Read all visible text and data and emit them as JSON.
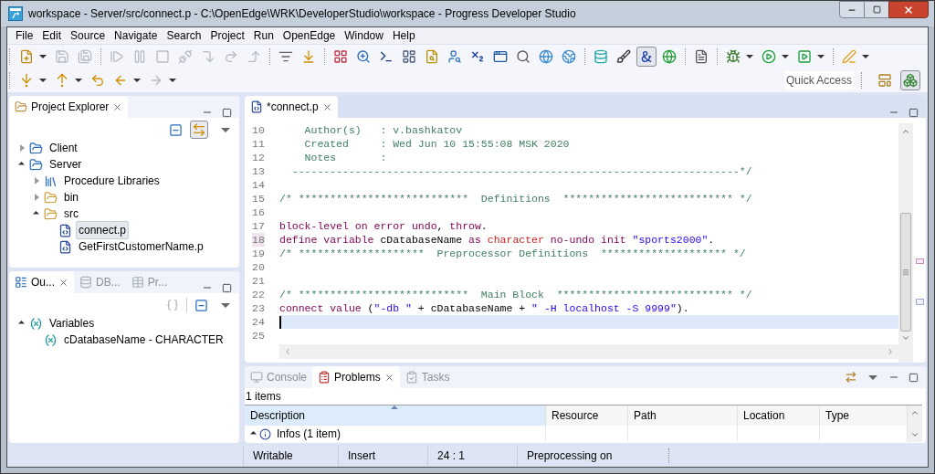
{
  "window": {
    "title": "workspace - Server/src/connect.p - C:\\OpenEdge\\WRK\\DeveloperStudio\\workspace - Progress Developer Studio"
  },
  "menu": [
    "File",
    "Edit",
    "Source",
    "Navigate",
    "Search",
    "Project",
    "Run",
    "OpenEdge",
    "Window",
    "Help"
  ],
  "toolbar_1": [
    {
      "kind": "new",
      "disabled": false,
      "pressed": false,
      "menu": true
    },
    {
      "kind": "save",
      "disabled": true,
      "pressed": false,
      "menu": false
    },
    {
      "kind": "save_all",
      "disabled": true,
      "pressed": false,
      "menu": false
    },
    {
      "kind": "separator"
    },
    {
      "kind": "resume",
      "disabled": true,
      "pressed": false,
      "menu": false
    },
    {
      "kind": "suspend",
      "disabled": true,
      "pressed": false,
      "menu": false
    },
    {
      "kind": "terminate",
      "disabled": true,
      "pressed": false,
      "menu": false
    },
    {
      "kind": "disconnect",
      "disabled": true,
      "pressed": false,
      "menu": false
    },
    {
      "kind": "step_into",
      "disabled": true,
      "pressed": false,
      "menu": false
    },
    {
      "kind": "step_over",
      "disabled": true,
      "pressed": false,
      "menu": false
    },
    {
      "kind": "step_return",
      "disabled": true,
      "pressed": false,
      "menu": false
    },
    {
      "kind": "separator"
    },
    {
      "kind": "step_filters",
      "disabled": false,
      "pressed": false,
      "menu": false
    },
    {
      "kind": "drop_frame",
      "disabled": false,
      "pressed": false,
      "menu": false
    },
    {
      "kind": "separator"
    },
    {
      "kind": "grid",
      "disabled": false,
      "pressed": false,
      "menu": false
    },
    {
      "kind": "zoom",
      "disabled": false,
      "pressed": false,
      "menu": false
    },
    {
      "kind": "terminal",
      "disabled": false,
      "pressed": false,
      "menu": false
    },
    {
      "kind": "layout",
      "disabled": false,
      "pressed": false,
      "menu": false
    },
    {
      "kind": "file_search",
      "disabled": false,
      "pressed": false,
      "menu": false
    },
    {
      "kind": "user_search",
      "disabled": false,
      "pressed": false,
      "menu": false
    },
    {
      "kind": "subscript",
      "disabled": false,
      "pressed": false,
      "menu": false
    },
    {
      "kind": "app_window",
      "disabled": false,
      "pressed": false,
      "menu": false
    },
    {
      "kind": "search",
      "disabled": false,
      "pressed": false,
      "menu": false
    },
    {
      "kind": "globe",
      "disabled": false,
      "pressed": false,
      "menu": false
    },
    {
      "kind": "earth",
      "disabled": false,
      "pressed": false,
      "menu": false
    },
    {
      "kind": "separator"
    },
    {
      "kind": "database",
      "disabled": false,
      "pressed": false,
      "menu": false
    },
    {
      "kind": "brush",
      "disabled": false,
      "pressed": false,
      "menu": false
    },
    {
      "kind": "ampersand",
      "disabled": false,
      "pressed": true,
      "menu": false
    },
    {
      "kind": "globe_run",
      "disabled": false,
      "pressed": false,
      "menu": false
    },
    {
      "kind": "separator"
    },
    {
      "kind": "document",
      "disabled": false,
      "pressed": false,
      "menu": false
    },
    {
      "kind": "separator"
    },
    {
      "kind": "debug",
      "disabled": false,
      "pressed": false,
      "menu": true
    },
    {
      "kind": "run",
      "disabled": false,
      "pressed": false,
      "menu": true
    },
    {
      "kind": "run_config",
      "disabled": false,
      "pressed": false,
      "menu": true
    },
    {
      "kind": "separator"
    },
    {
      "kind": "pen",
      "disabled": false,
      "pressed": false,
      "menu": true
    }
  ],
  "toolbar_2": [
    {
      "kind": "next_annotation",
      "disabled": false,
      "pressed": false,
      "menu": true
    },
    {
      "kind": "prev_annotation",
      "disabled": false,
      "pressed": false,
      "menu": true
    },
    {
      "kind": "last_edit",
      "disabled": false,
      "pressed": false,
      "menu": false
    },
    {
      "kind": "back",
      "disabled": false,
      "pressed": false,
      "menu": true
    },
    {
      "kind": "forward",
      "disabled": true,
      "pressed": false,
      "menu": true
    }
  ],
  "quick_access": {
    "placeholder": "Quick Access"
  },
  "perspectives": [
    {
      "kind": "layout_add",
      "selected": false
    },
    {
      "kind": "openedge",
      "selected": true
    }
  ],
  "project_explorer": {
    "tabs": [
      {
        "label": "Project Explorer",
        "selected": true
      }
    ],
    "link_with_editor": true,
    "tree": [
      {
        "label": "Client",
        "kind": "project",
        "expanded": false,
        "selected": false
      },
      {
        "label": "Server",
        "kind": "project",
        "expanded": true,
        "selected": false,
        "children": [
          {
            "label": "Procedure Libraries",
            "kind": "library",
            "expanded": false,
            "selected": false
          },
          {
            "label": "bin",
            "kind": "folder",
            "expanded": false,
            "selected": false
          },
          {
            "label": "src",
            "kind": "folder",
            "expanded": true,
            "selected": false,
            "children": [
              {
                "label": "connect.p",
                "kind": "file",
                "selected": true
              },
              {
                "label": "GetFirstCustomerName.p",
                "kind": "file",
                "selected": false
              }
            ]
          }
        ]
      }
    ]
  },
  "outline": {
    "tabs": [
      {
        "label": "Ou...",
        "kind": "outline",
        "selected": true
      },
      {
        "label": "DB...",
        "kind": "db",
        "selected": false
      },
      {
        "label": "Pr...",
        "kind": "properties",
        "selected": false
      }
    ],
    "tree": [
      {
        "label": "Variables",
        "kind": "group",
        "expanded": true,
        "children": [
          {
            "label": "cDatabaseName - CHARACTER",
            "kind": "variable"
          }
        ]
      }
    ]
  },
  "editor": {
    "tabs": [
      {
        "label": "*connect.p",
        "selected": true
      }
    ],
    "lines": [
      {
        "number": "10",
        "current": false,
        "marked": false,
        "tokens": [
          {
            "kind": "comment",
            "text": "    Author(s)   : v.bashkatov"
          }
        ]
      },
      {
        "number": "11",
        "current": false,
        "marked": false,
        "tokens": [
          {
            "kind": "comment",
            "text": "    Created     : Wed Jun 10 15:55:08 MSK 2020"
          }
        ]
      },
      {
        "number": "12",
        "current": false,
        "marked": false,
        "tokens": [
          {
            "kind": "comment",
            "text": "    Notes       :"
          }
        ]
      },
      {
        "number": "13",
        "current": false,
        "marked": false,
        "tokens": [
          {
            "kind": "comment",
            "text": "  -----------------------------------------------------------------------*/"
          }
        ]
      },
      {
        "number": "14",
        "current": false,
        "marked": false
      },
      {
        "number": "15",
        "current": false,
        "marked": false,
        "tokens": [
          {
            "kind": "comment",
            "text": "/* ***************************  Definitions  *************************** */"
          }
        ]
      },
      {
        "number": "16",
        "current": false,
        "marked": false
      },
      {
        "number": "17",
        "current": false,
        "marked": false,
        "tokens": [
          {
            "kind": "keyword",
            "text": "block-level on error undo"
          },
          {
            "kind": "plain",
            "text": ", "
          },
          {
            "kind": "keyword",
            "text": "throw"
          },
          {
            "kind": "plain",
            "text": "."
          }
        ]
      },
      {
        "number": "18",
        "current": false,
        "marked": true,
        "tokens": [
          {
            "kind": "keyword",
            "text": "define variable"
          },
          {
            "kind": "plain",
            "text": " cDatabaseName "
          },
          {
            "kind": "keyword",
            "text": "as "
          },
          {
            "kind": "type",
            "text": "character "
          },
          {
            "kind": "keyword",
            "text": "no-undo init "
          },
          {
            "kind": "string",
            "text": "\"sports2000\""
          },
          {
            "kind": "plain",
            "text": "."
          }
        ]
      },
      {
        "number": "19",
        "current": false,
        "marked": false,
        "tokens": [
          {
            "kind": "comment",
            "text": "/* ********************  Preprocessor Definitions  ******************** */"
          }
        ]
      },
      {
        "number": "20",
        "current": false,
        "marked": false
      },
      {
        "number": "21",
        "current": false,
        "marked": false
      },
      {
        "number": "22",
        "current": false,
        "marked": false,
        "tokens": [
          {
            "kind": "comment",
            "text": "/* ***************************  Main Block  **************************** */"
          }
        ]
      },
      {
        "number": "23",
        "current": false,
        "marked": false,
        "tokens": [
          {
            "kind": "keyword",
            "text": "connect value"
          },
          {
            "kind": "plain",
            "text": " ("
          },
          {
            "kind": "string",
            "text": "\"-db \""
          },
          {
            "kind": "plain",
            "text": " + cDatabaseName + "
          },
          {
            "kind": "string",
            "text": "\" -H localhost -S 9999\""
          },
          {
            "kind": "plain",
            "text": ")."
          }
        ]
      },
      {
        "number": "24",
        "current": true,
        "marked": false
      },
      {
        "number": "25",
        "current": false,
        "marked": false
      }
    ]
  },
  "problems": {
    "tabs": [
      {
        "label": "Console",
        "kind": "console",
        "selected": false
      },
      {
        "label": "Problems",
        "kind": "problems",
        "selected": true
      },
      {
        "label": "Tasks",
        "kind": "tasks",
        "selected": false
      }
    ],
    "summary": "1 items",
    "columns": [
      {
        "label": "Description",
        "sorted": true
      },
      {
        "label": "Resource",
        "sorted": false
      },
      {
        "label": "Path",
        "sorted": false
      },
      {
        "label": "Location",
        "sorted": false
      },
      {
        "label": "Type",
        "sorted": false
      }
    ],
    "rows": [
      {
        "description": "Infos (1 item)",
        "expanded": true
      }
    ]
  },
  "status_bar": [
    "Writable",
    "Insert",
    "24 : 1",
    "Preprocessing on"
  ]
}
